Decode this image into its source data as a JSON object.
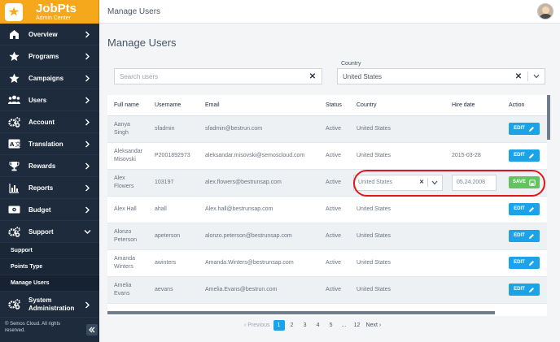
{
  "brand": {
    "name": "JobPts",
    "subtitle": "Admin Center"
  },
  "sidebar": {
    "items": [
      {
        "label": "Overview",
        "icon": "dashboard-icon"
      },
      {
        "label": "Programs",
        "icon": "star-icon"
      },
      {
        "label": "Campaigns",
        "icon": "star-icon"
      },
      {
        "label": "Users",
        "icon": "users-icon"
      },
      {
        "label": "Account",
        "icon": "gears-icon"
      },
      {
        "label": "Translation",
        "icon": "translate-icon"
      },
      {
        "label": "Rewards",
        "icon": "trophy-icon"
      },
      {
        "label": "Reports",
        "icon": "bar-chart-icon"
      },
      {
        "label": "Budget",
        "icon": "money-icon"
      },
      {
        "label": "Support",
        "icon": "gear-icon"
      }
    ],
    "sub_items": [
      {
        "label": "Support"
      },
      {
        "label": "Points Type"
      },
      {
        "label": "Manage Users"
      }
    ],
    "system": {
      "label_line1": "System",
      "label_line2": "Administration"
    },
    "footer": {
      "line1": "© Semos Cloud. All rights",
      "line2": "reserved."
    }
  },
  "topbar": {
    "title": "Manage Users"
  },
  "page": {
    "title": "Manage Users",
    "search_placeholder": "Search users",
    "country_label": "Country",
    "country_value": "United States"
  },
  "table": {
    "headers": [
      "Full name",
      "Username",
      "Email",
      "Status",
      "Country",
      "Hire date",
      "Action"
    ],
    "rows": [
      {
        "name": "Aanya\nSingh",
        "username": "sfadmin",
        "email": "sfadmin@bestrun.com",
        "status": "Active",
        "country": "United States",
        "hire": "",
        "action": "EDIT"
      },
      {
        "name": "Aleksandar\nMisovski",
        "username": "P2001892973",
        "email": "aleksandar.misovski@semoscloud.com",
        "status": "Active",
        "country": "United States",
        "hire": "2015-03-28",
        "action": "EDIT"
      },
      {
        "name": "Alex\nFlowers",
        "username": "103197",
        "email": "alex.flowers@bestrunsap.com",
        "status": "Active",
        "country": "United States",
        "hire": "05.24.2008",
        "action": "SAVE"
      },
      {
        "name": "Alex Hall",
        "username": "ahall",
        "email": "Alex.hall@bestrunsap.com",
        "status": "Active",
        "country": "United States",
        "hire": "",
        "action": "EDIT"
      },
      {
        "name": "Alonzo\nPeterson",
        "username": "apeterson",
        "email": "alonzo.peterson@bestrunsap.com",
        "status": "Active",
        "country": "United States",
        "hire": "",
        "action": "EDIT"
      },
      {
        "name": "Amanda\nWinters",
        "username": "awinters",
        "email": "Amanda.Winters@bestrunsap.com",
        "status": "Active",
        "country": "United States",
        "hire": "",
        "action": "EDIT"
      },
      {
        "name": "Amelia\nEvans",
        "username": "aevans",
        "email": "Amelia.Evans@bestrun.com",
        "status": "Active",
        "country": "United States",
        "hire": "",
        "action": "EDIT"
      }
    ]
  },
  "pagination": {
    "previous": "Previous",
    "pages": [
      "1",
      "2",
      "3",
      "4",
      "5",
      "...",
      "12"
    ],
    "next": "Next",
    "current": "1"
  },
  "colors": {
    "accent": "#f6a81c",
    "sidebar": "#1d2b3d",
    "edit": "#1aa3e8",
    "save": "#62c35f",
    "highlight": "#e0161b"
  }
}
